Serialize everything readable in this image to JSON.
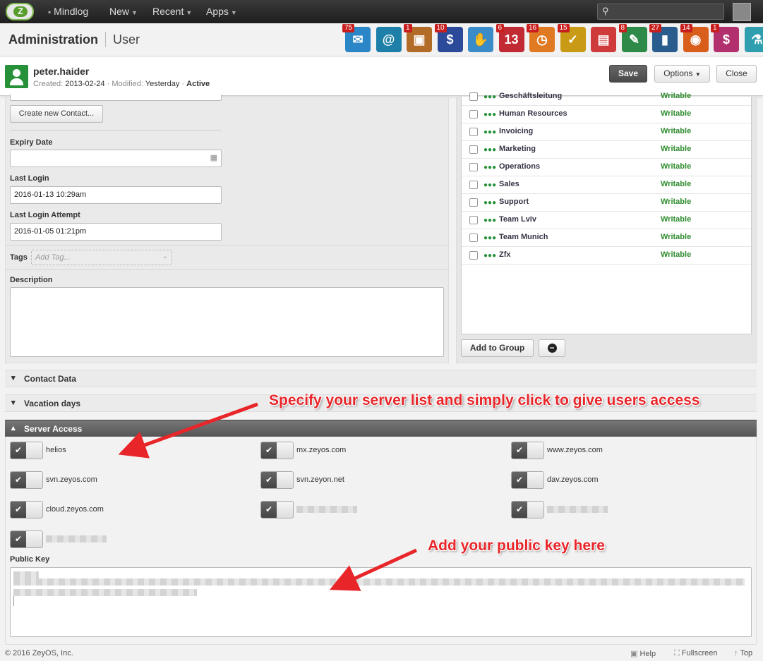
{
  "topbar": {
    "nav": [
      {
        "label": "Mindlog"
      },
      {
        "label": "New"
      },
      {
        "label": "Recent"
      },
      {
        "label": "Apps"
      }
    ],
    "search_placeholder": ""
  },
  "header": {
    "title": "Administration",
    "subtitle": "User",
    "apps": [
      {
        "icon": "mail-icon",
        "badge": "75",
        "color": "#2a86c7",
        "glyph": "✉"
      },
      {
        "icon": "address-book-icon",
        "badge": "",
        "color": "#1e7fa8",
        "glyph": "@"
      },
      {
        "icon": "contacts-icon",
        "badge": "1",
        "color": "#b36b28",
        "glyph": "▣"
      },
      {
        "icon": "dollar-icon",
        "badge": "10",
        "color": "#2b4a9a",
        "glyph": "$"
      },
      {
        "icon": "handshake-icon",
        "badge": "",
        "color": "#3a8cc9",
        "glyph": "✋"
      },
      {
        "icon": "calendar-icon",
        "badge": "6",
        "color": "#c12a33",
        "glyph": "13"
      },
      {
        "icon": "stopwatch-icon",
        "badge": "16",
        "color": "#e07a22",
        "glyph": "◷"
      },
      {
        "icon": "tasks-icon",
        "badge": "15",
        "color": "#c99a16",
        "glyph": "✓"
      },
      {
        "icon": "document-icon",
        "badge": "",
        "color": "#cf3a3a",
        "glyph": "▤"
      },
      {
        "icon": "notes-icon",
        "badge": "8",
        "color": "#2e8a49",
        "glyph": "✎"
      },
      {
        "icon": "bookmark-icon",
        "badge": "27",
        "color": "#2a5d8e",
        "glyph": "▮"
      },
      {
        "icon": "broadcast-icon",
        "badge": "14",
        "color": "#d95e1b",
        "glyph": "◉"
      },
      {
        "icon": "cashier-icon",
        "badge": "1",
        "color": "#b3306f",
        "glyph": "$"
      },
      {
        "icon": "flask-icon",
        "badge": "",
        "color": "#2f9fb0",
        "glyph": "⚗"
      }
    ]
  },
  "user": {
    "name": "peter.haider",
    "created_label": "Created:",
    "created": "2013-02-24",
    "modified_label": "Modified:",
    "modified": "Yesterday",
    "status": "Active",
    "save_label": "Save",
    "options_label": "Options",
    "close_label": "Close"
  },
  "form": {
    "create_contact_label": "Create new Contact...",
    "expiry_label": "Expiry Date",
    "expiry_value": "",
    "last_login_label": "Last Login",
    "last_login_value": "2016-01-13 10:29am",
    "last_attempt_label": "Last Login Attempt",
    "last_attempt_value": "2016-01-05 01:21pm",
    "tags_label": "Tags",
    "tags_placeholder": "Add Tag...",
    "description_label": "Description",
    "description_value": ""
  },
  "groups": {
    "items": [
      {
        "name": "Geschäftsleitung",
        "perm": "Writable"
      },
      {
        "name": "Human Resources",
        "perm": "Writable"
      },
      {
        "name": "Invoicing",
        "perm": "Writable"
      },
      {
        "name": "Marketing",
        "perm": "Writable"
      },
      {
        "name": "Operations",
        "perm": "Writable"
      },
      {
        "name": "Sales",
        "perm": "Writable"
      },
      {
        "name": "Support",
        "perm": "Writable"
      },
      {
        "name": "Team Lviv",
        "perm": "Writable"
      },
      {
        "name": "Team Munich",
        "perm": "Writable"
      },
      {
        "name": "Zfx",
        "perm": "Writable"
      }
    ],
    "add_label": "Add to Group"
  },
  "sections": {
    "contact_data": "Contact Data",
    "vacation_days": "Vacation days",
    "server_access": "Server Access"
  },
  "servers": [
    {
      "name": "helios",
      "enabled": true
    },
    {
      "name": "mx.zeyos.com",
      "enabled": true
    },
    {
      "name": "www.zeyos.com",
      "enabled": true
    },
    {
      "name": "svn.zeyos.com",
      "enabled": true
    },
    {
      "name": "svn.zeyon.net",
      "enabled": true
    },
    {
      "name": "dav.zeyos.com",
      "enabled": true
    },
    {
      "name": "cloud.zeyos.com",
      "enabled": true
    },
    {
      "name": "",
      "enabled": true
    },
    {
      "name": "",
      "enabled": true
    },
    {
      "name": "",
      "enabled": true
    }
  ],
  "public_key": {
    "label": "Public Key"
  },
  "annotations": {
    "server_hint": "Specify your server list and simply click to give users access",
    "key_hint": "Add your public key here"
  },
  "footer": {
    "copyright": "© 2016 ZeyOS, Inc.",
    "help": "Help",
    "fullscreen": "Fullscreen",
    "top": "Top"
  }
}
